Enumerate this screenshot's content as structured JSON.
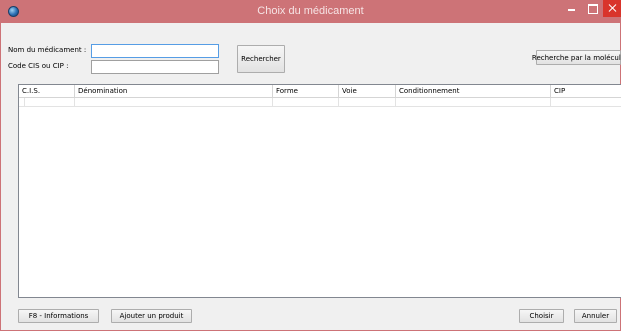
{
  "window": {
    "title": "Choix du médicament",
    "icon": "globe-icon"
  },
  "search": {
    "name_label": "Nom du médicament :",
    "name_value": "",
    "code_label": "Code CIS ou CIP :",
    "code_value": "",
    "search_button": "Rechercher",
    "molecule_button": "Recherche par la molécule"
  },
  "table": {
    "columns": [
      "C.I.S.",
      "Dénomination",
      "Forme",
      "Voie",
      "Conditionnement",
      "CIP"
    ],
    "rows": []
  },
  "footer": {
    "info_button": "F8 - Informations",
    "add_button": "Ajouter un produit",
    "choose_button": "Choisir",
    "cancel_button": "Annuler"
  },
  "colors": {
    "titlebar": "#cd7377",
    "close": "#d9342b",
    "focus": "#569de5"
  }
}
